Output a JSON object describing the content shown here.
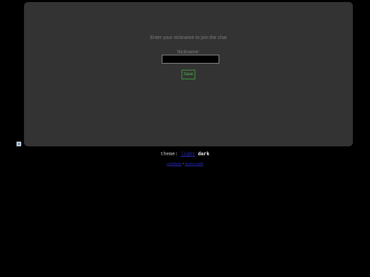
{
  "join_panel": {
    "prompt": "Enter your nickname to join the chat",
    "nickname_label": "Nickname:",
    "nickname_value": "",
    "save_label": "Save"
  },
  "theme": {
    "label": "theme:",
    "light": "light",
    "dark": "dark",
    "current": "dark"
  },
  "footer": {
    "link1": "contribute",
    "separator": "•",
    "link2": "source code"
  },
  "colors": {
    "background": "#000000",
    "panel": "#333333",
    "accent_green": "#4fbf4f",
    "link_blue": "#2b2bc4"
  }
}
